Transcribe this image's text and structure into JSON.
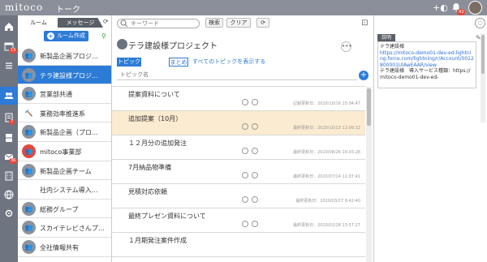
{
  "app": {
    "logo": "mitoco",
    "title": "トーク"
  },
  "header": {
    "notification_count": "43"
  },
  "rail": {
    "badges": [
      "13",
      "7",
      "36"
    ]
  },
  "sidebar": {
    "tabs": [
      "ルーム",
      "メッセージ"
    ],
    "create_button": "ルーム作成",
    "rooms": [
      {
        "name": "新製品企画プロジ…",
        "active": false
      },
      {
        "name": "テラ建設様プロジ…",
        "active": true
      },
      {
        "name": "営業部共通",
        "active": false
      },
      {
        "name": "業務効率推進系",
        "active": false
      },
      {
        "name": "新製品企画（プロ…",
        "active": false
      },
      {
        "name": "mitoco事業部",
        "active": false
      },
      {
        "name": "新製品企画チーム",
        "active": false
      },
      {
        "name": "社内システム導入…",
        "active": false
      },
      {
        "name": "総務グループ",
        "active": false
      },
      {
        "name": "スカイテレビさんプ…",
        "active": false
      },
      {
        "name": "全社情報共有",
        "active": false
      }
    ]
  },
  "main": {
    "search_placeholder": "キーワード",
    "search_button": "検索",
    "clear_button": "クリア",
    "project_title": "テラ建設様プロジェクト",
    "tabs": [
      "トピック",
      "まとめ",
      "すべてのトピックを表示する"
    ],
    "topic_placeholder": "トピック名",
    "topics": [
      {
        "name": "提案資料について",
        "date": "記録更新日：2020/10/16 15:04:47",
        "highlight": false
      },
      {
        "name": "追加提案（10月）",
        "date": "最終更新日：2020/10/13 12:09:32",
        "highlight": true
      },
      {
        "name": "１２月分の追加発注",
        "date": "最終更新日：2020/08/26 16:03:28",
        "highlight": false
      },
      {
        "name": "7月納品物準備",
        "date": "最終更新日：2020/07/14 11:07:41",
        "highlight": false
      },
      {
        "name": "見積対応依頼",
        "date": "最終更新日：2020/03/27 8:42:40",
        "highlight": false
      },
      {
        "name": "最終プレゼン資料について",
        "date": "最終更新日：2020/02/28 13:57:27",
        "highlight": false
      },
      {
        "name": "１月期発注案件作成",
        "date": "",
        "highlight": false
      }
    ]
  },
  "panel": {
    "desc_tab": "説明",
    "desc_lines": [
      {
        "text": "テラ建設様",
        "link": false
      },
      {
        "text": "https://mitoco-demo01-dev-ed.lightning.force.com/lightning/r/Account/0012800001UlAwEAAR/view",
        "link": true
      },
      {
        "text": "テラ建設様　導入サービス種類：https://mitoco-demo01-dev-ed-",
        "link": false
      }
    ]
  }
}
